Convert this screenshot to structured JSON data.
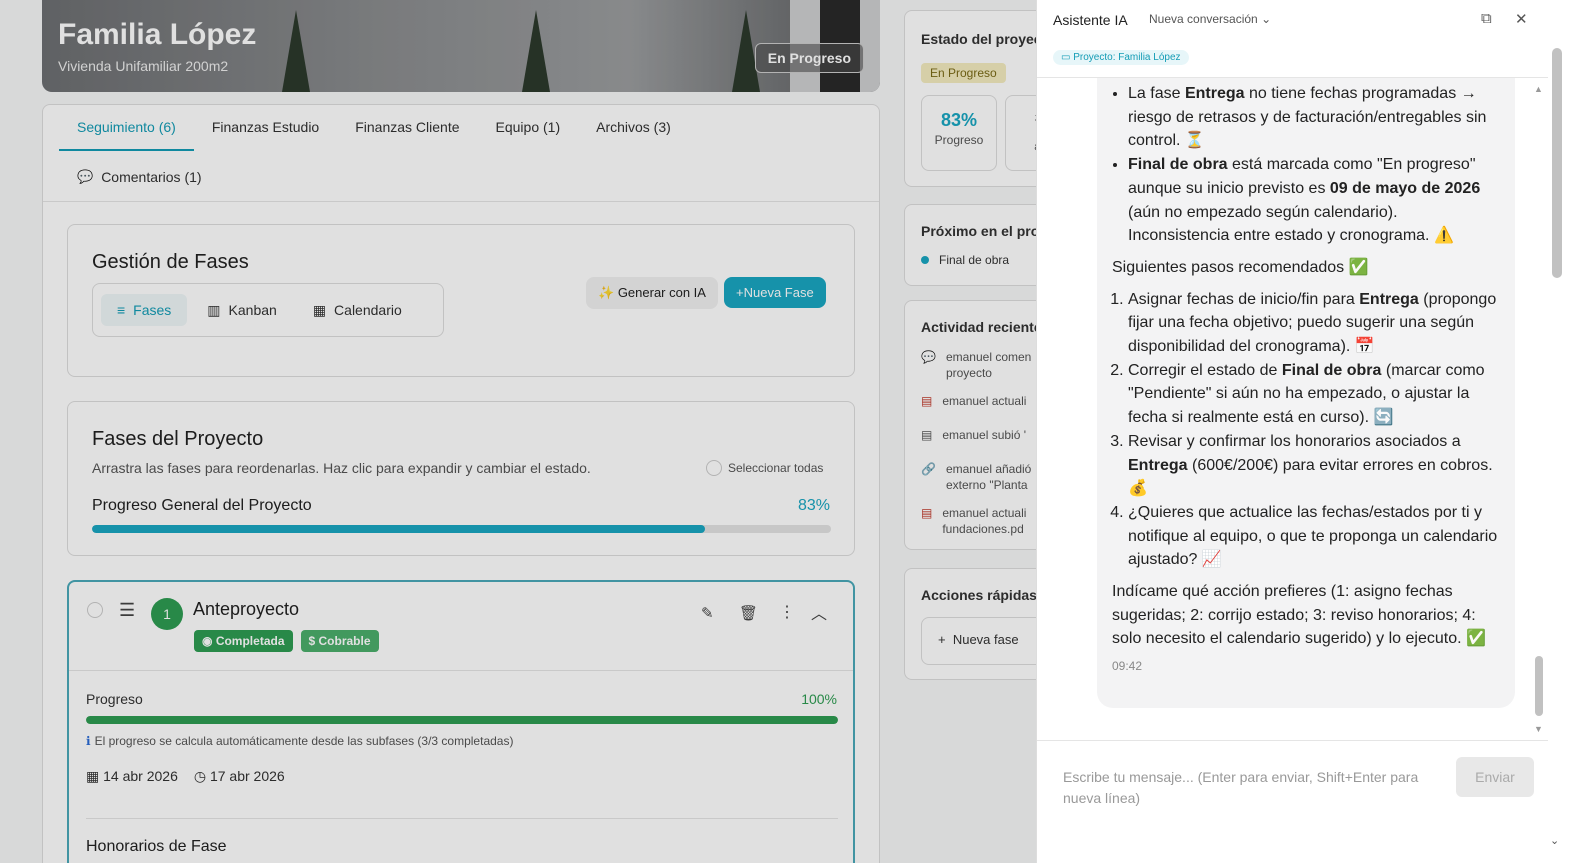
{
  "project": {
    "title": "Familia López",
    "subtitle": "Vivienda Unifamiliar 200m2",
    "status": "En Progreso"
  },
  "tabs": [
    {
      "label": "Seguimiento (6)"
    },
    {
      "label": "Finanzas Estudio"
    },
    {
      "label": "Finanzas Cliente"
    },
    {
      "label": "Equipo (1)"
    },
    {
      "label": "Archivos (3)"
    }
  ],
  "comments_tab": "Comentarios (1)",
  "fases_mgmt": {
    "title": "Gestión de Fases",
    "views": [
      "Fases",
      "Kanban",
      "Calendario"
    ],
    "gen_ai": "Generar con IA",
    "new_phase": "Nueva Fase"
  },
  "fases_proyecto": {
    "title": "Fases del Proyecto",
    "hint": "Arrastra las fases para reordenarlas. Haz clic para expandir y cambiar el estado.",
    "select_all": "Seleccionar todas",
    "progress_label": "Progreso General del Proyecto",
    "progress_pct": "83%",
    "progress_value": 0.83
  },
  "phase": {
    "number": "1",
    "name": "Anteproyecto",
    "badge_done": "Completada",
    "badge_billable": "Cobrable",
    "progress_label": "Progreso",
    "progress_pct": "100%",
    "progress_value": 1.0,
    "auto_note": "El progreso se calcula automáticamente desde las subfases (3/3 completadas)",
    "date_start": "14 abr 2026",
    "date_end": "17 abr 2026",
    "fees_title": "Honorarios de Fase"
  },
  "side": {
    "estado_title": "Estado del proyec",
    "estado_badge": "En Progreso",
    "stat_pct": "83%",
    "stat_label": "Progreso",
    "stat2_top": "#",
    "stat2_mid": "F",
    "stat2_bot": "ac",
    "proximo_title": "Próximo en el pro",
    "proximo_item": "Final de obra",
    "actividad_title": "Actividad reciente",
    "activities": [
      {
        "line1": "emanuel comen",
        "line2": "proyecto"
      },
      {
        "line1": "emanuel actuali",
        "line2": ""
      },
      {
        "line1": "emanuel subió '",
        "line2": ""
      },
      {
        "line1": "emanuel añadió",
        "line2": "externo \"Planta"
      },
      {
        "line1": "emanuel actuali",
        "line2": "fundaciones.pd"
      }
    ],
    "acciones_title": "Acciones rápidas",
    "nueva_fase": "Nueva fase"
  },
  "assistant": {
    "title": "Asistente IA",
    "conversation": "Nueva conversación",
    "chip": "Proyecto: Familia López",
    "bullets": [
      {
        "pre": "La fase ",
        "b1": "Entrega",
        "post": " no tiene fechas programadas → riesgo de retrasos y de facturación/entregables sin control. ⏳"
      },
      {
        "pre": "",
        "b1": "Final de obra",
        "post": " está marcada como \"En progreso\" aunque su inicio previsto es ",
        "b2": "09 de mayo de 2026",
        "post2": " (aún no empezado según calendario). Inconsistencia entre estado y cronograma. ⚠️"
      }
    ],
    "next_steps": "Siguientes pasos recomendados ✅",
    "steps": [
      {
        "pre": "Asignar fechas de inicio/fin para ",
        "b": "Entrega",
        "post": " (propongo fijar una fecha objetivo; puedo sugerir una según disponibilidad del cronograma). 📅"
      },
      {
        "pre": "Corregir el estado de ",
        "b": "Final de obra",
        "post": " (marcar como \"Pendiente\" si aún no ha empezado, o ajustar la fecha si realmente está en curso). 🔄"
      },
      {
        "pre": "Revisar y confirmar los honorarios asociados a ",
        "b": "Entrega",
        "post": " (600€/200€) para evitar errores en cobros. 💰"
      },
      {
        "pre": "¿Quieres que actualice las fechas/estados por ti y notifique al equipo, o que te proponga un calendario ajustado? 📈",
        "b": "",
        "post": ""
      }
    ],
    "closing": "Indícame qué acción prefieres (1: asigno fechas sugeridas; 2: corrijo estado; 3: reviso honorarios; 4: solo necesito el calendario sugerido) y lo ejecuto. ✅",
    "time": "09:42",
    "input_placeholder": "Escribe tu mensaje... (Enter para enviar, Shift+Enter para nueva línea)",
    "send": "Enviar"
  },
  "colors": {
    "accent": "#1aa7c2",
    "success": "#2e9d52",
    "badge_bg": "#f4ecc0"
  }
}
